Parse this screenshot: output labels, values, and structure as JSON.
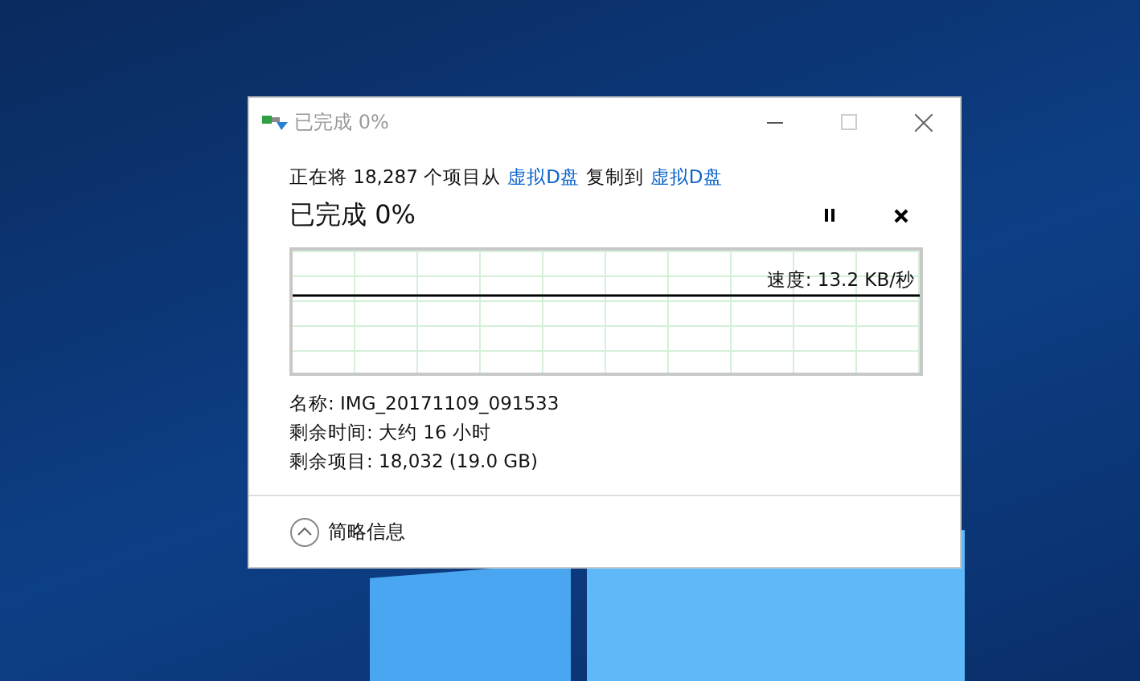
{
  "window": {
    "title": "已完成 0%"
  },
  "summary": [
    {
      "kind": "text",
      "text": "正在将 18,287 个项目从"
    },
    {
      "kind": "link",
      "text": "虚拟D盘"
    },
    {
      "kind": "text",
      "text": "复制到"
    },
    {
      "kind": "link",
      "text": "虚拟D盘"
    }
  ],
  "headline": "已完成 0%",
  "progress": {
    "level": 0,
    "speed": "速度: 13.2 KB/秒"
  },
  "details": [
    "名称: IMG_20171109_091533",
    "剩余时间: 大约 16 小时",
    "剩余项目: 18,032 (19.0 GB)"
  ],
  "footer": {
    "label": "简略信息",
    "expanded": true
  }
}
